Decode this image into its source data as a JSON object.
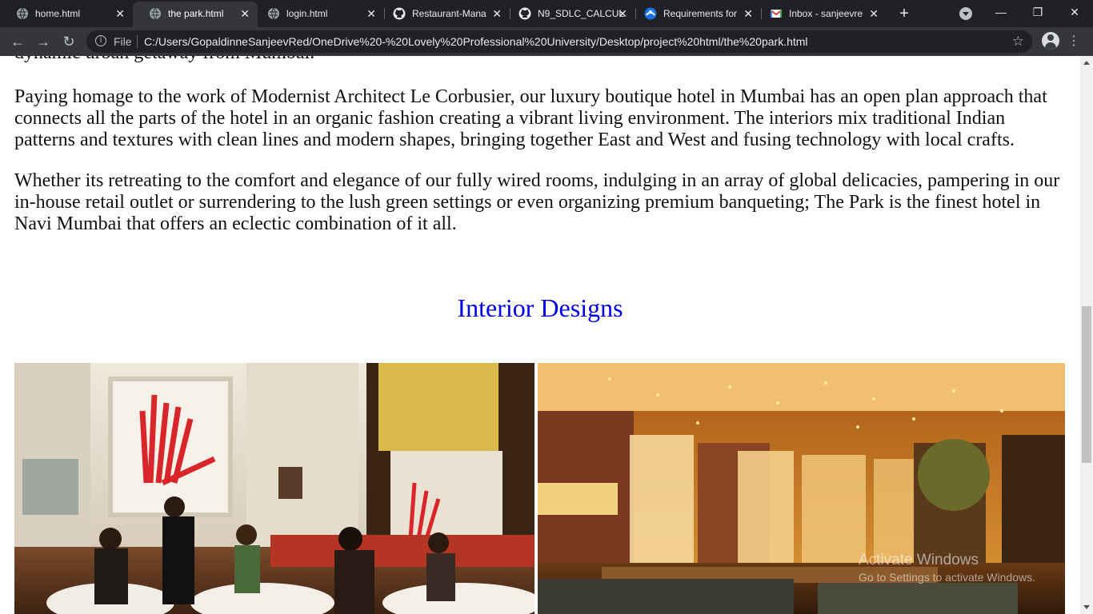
{
  "browser": {
    "tabs": [
      {
        "label": "home.html",
        "icon": "globe-icon",
        "active": false
      },
      {
        "label": "the park.html",
        "icon": "globe-icon",
        "active": true
      },
      {
        "label": "login.html",
        "icon": "globe-icon",
        "active": false
      },
      {
        "label": "Restaurant-Mana",
        "icon": "github-icon",
        "active": false
      },
      {
        "label": "N9_SDLC_CALCUL",
        "icon": "github-icon",
        "active": false
      },
      {
        "label": "Requirements for",
        "icon": "requirements-icon",
        "active": false
      },
      {
        "label": "Inbox - sanjeevre",
        "icon": "gmail-icon",
        "active": false
      }
    ],
    "new_tab": "+",
    "omnibox": {
      "scheme_label": "File",
      "url": "C:/Users/GopaldinneSanjeevRed/OneDrive%20-%20Lovely%20Professional%20University/Desktop/project%20html/the%20park.html"
    },
    "window_controls": {
      "minimize": "—",
      "maximize": "❐",
      "close": "✕"
    }
  },
  "page": {
    "clipped_paragraph_tail": "dynamic urban getaway from Mumbai.",
    "paragraphs": [
      "Paying homage to the work of Modernist Architect Le Corbusier, our luxury boutique hotel in Mumbai has an open plan approach that connects all the parts of the hotel in an organic fashion creating a vibrant living environment. The interiors mix traditional Indian patterns and textures with clean lines and modern shapes, bringing together East and West and fusing technology with local crafts.",
      "Whether its retreating to the comfort and elegance of our fully wired rooms, indulging in an array of global delicacies, pampering in our in-house retail outlet or surrendering to the lush green settings or even organizing premium banqueting; The Park is the finest hotel in Navi Mumbai that offers an eclectic combination of it all."
    ],
    "section_title": "Interior Designs",
    "title_color": "#0000ee"
  },
  "watermark": {
    "title": "Activate Windows",
    "subtitle": "Go to Settings to activate Windows."
  }
}
